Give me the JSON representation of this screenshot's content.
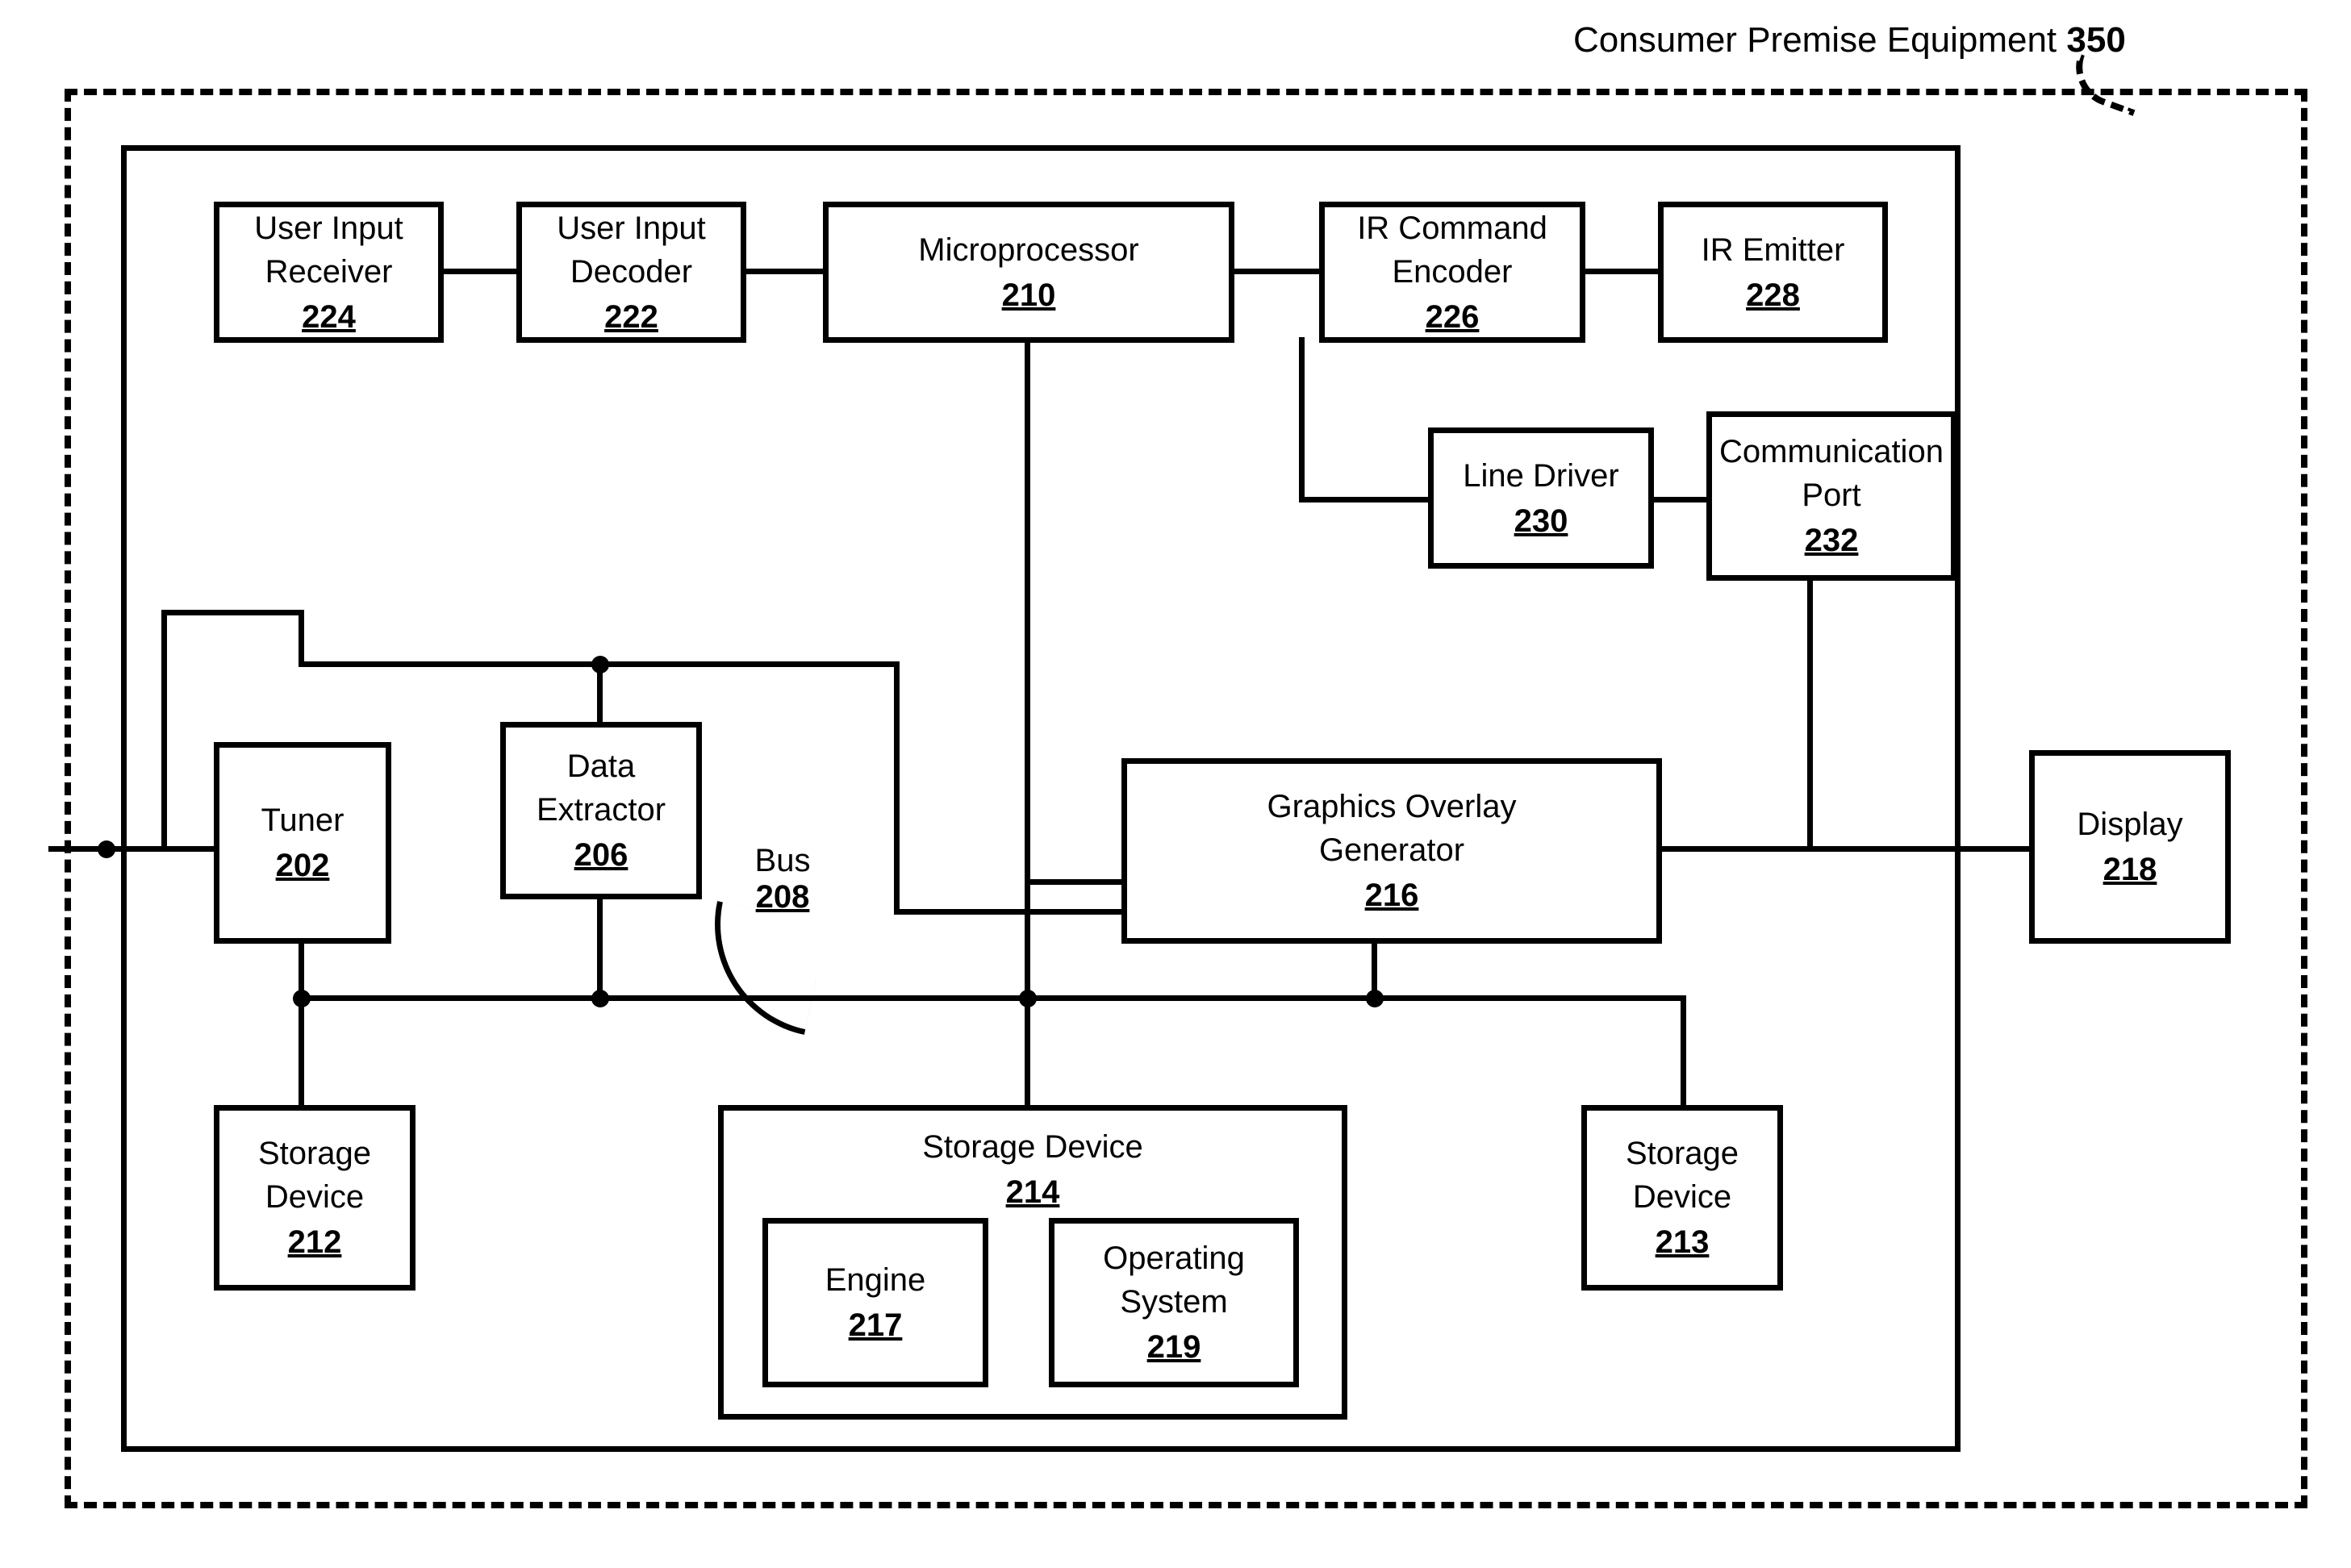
{
  "title": {
    "label": "Consumer Premise Equipment",
    "ref": "350"
  },
  "bus": {
    "label": "Bus",
    "ref": "208"
  },
  "blocks": {
    "userInputReceiver": {
      "label": "User Input\nReceiver",
      "ref": "224"
    },
    "userInputDecoder": {
      "label": "User Input\nDecoder",
      "ref": "222"
    },
    "microprocessor": {
      "label": "Microprocessor",
      "ref": "210"
    },
    "irCommandEncoder": {
      "label": "IR Command\nEncoder",
      "ref": "226"
    },
    "irEmitter": {
      "label": "IR Emitter",
      "ref": "228"
    },
    "lineDriver": {
      "label": "Line Driver",
      "ref": "230"
    },
    "communicationPort": {
      "label": "Communication\nPort",
      "ref": "232"
    },
    "tuner": {
      "label": "Tuner",
      "ref": "202"
    },
    "dataExtractor": {
      "label": "Data\nExtractor",
      "ref": "206"
    },
    "graphicsOverlay": {
      "label": "Graphics Overlay\nGenerator",
      "ref": "216"
    },
    "display": {
      "label": "Display",
      "ref": "218"
    },
    "storage212": {
      "label": "Storage\nDevice",
      "ref": "212"
    },
    "storage213": {
      "label": "Storage\nDevice",
      "ref": "213"
    },
    "storage214": {
      "label": "Storage Device",
      "ref": "214"
    },
    "engine": {
      "label": "Engine",
      "ref": "217"
    },
    "operatingSystem": {
      "label": "Operating\nSystem",
      "ref": "219"
    }
  }
}
